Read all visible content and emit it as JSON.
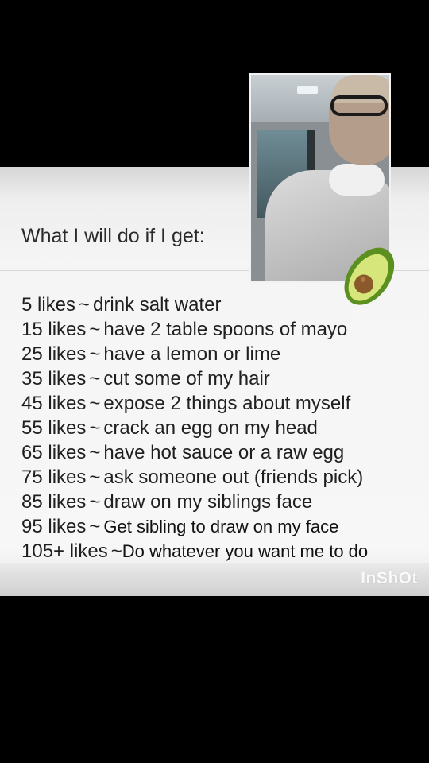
{
  "screen": {
    "title": "What I will do if I get:",
    "rules": [
      {
        "count": "5 likes",
        "sep": "~",
        "action": "drink salt water"
      },
      {
        "count": "15 likes",
        "sep": "~",
        "action": "have 2 table spoons of mayo"
      },
      {
        "count": "25 likes",
        "sep": "~",
        "action": "have a lemon or lime"
      },
      {
        "count": "35 likes",
        "sep": "~",
        "action": "cut some of my hair"
      },
      {
        "count": "45 likes",
        "sep": "~",
        "action": "expose 2 things about myself"
      },
      {
        "count": "55 likes",
        "sep": "~",
        "action": "crack an egg on my head"
      },
      {
        "count": "65 likes",
        "sep": "~",
        "action": "have hot sauce or a raw egg"
      },
      {
        "count": "75 likes",
        "sep": "~",
        "action": "ask someone out (friends pick)"
      },
      {
        "count": "85 likes",
        "sep": "~",
        "action": "draw on my siblings face"
      },
      {
        "count": "95 likes",
        "sep": "~",
        "action": "Get sibling to draw on my face"
      },
      {
        "count": "105+ likes",
        "sep": "~",
        "action": "Do whatever you want me to do"
      }
    ],
    "watermark": "InShOt"
  },
  "stickers": {
    "avocado": "avocado-emoji"
  },
  "colors": {
    "background": "#000000",
    "panel": "#f5f5f5",
    "text": "#1f1f1f"
  }
}
